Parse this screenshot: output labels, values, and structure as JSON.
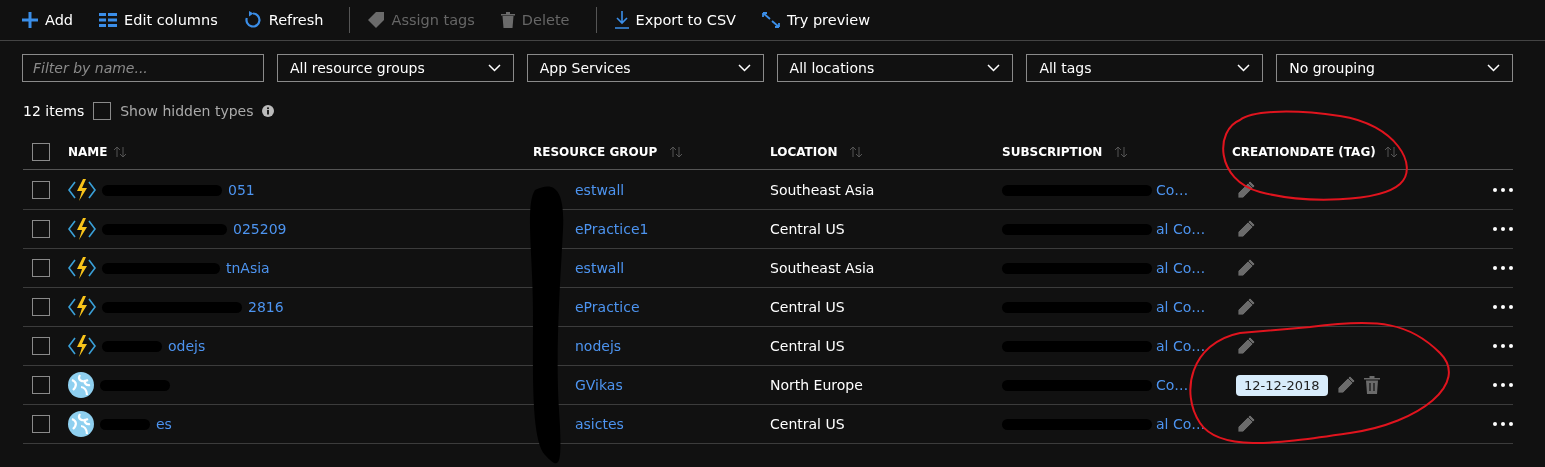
{
  "toolbar": [
    {
      "kind": "add",
      "label": "Add",
      "disabled": false
    },
    {
      "kind": "columns",
      "label": "Edit columns",
      "disabled": false
    },
    {
      "kind": "refresh",
      "label": "Refresh",
      "disabled": false
    },
    {
      "kind": "tag",
      "label": "Assign tags",
      "disabled": true
    },
    {
      "kind": "delete",
      "label": "Delete",
      "disabled": true
    },
    {
      "kind": "export",
      "label": "Export to CSV",
      "disabled": false
    },
    {
      "kind": "preview",
      "label": "Try preview",
      "disabled": false
    }
  ],
  "filter": {
    "placeholder": "Filter by name..."
  },
  "dropdowns": [
    "All resource groups",
    "App Services",
    "All locations",
    "All tags",
    "No grouping"
  ],
  "count": "12 items",
  "show_hidden": {
    "label": "Show hidden types",
    "checked": false
  },
  "select_all": {
    "checked": false
  },
  "columns": [
    "NAME",
    "RESOURCE GROUP",
    "LOCATION",
    "SUBSCRIPTION",
    "CREATIONDATE (TAG)"
  ],
  "rows": [
    {
      "kind": "function",
      "name": "051",
      "group": "estwall",
      "location": "Southeast Asia",
      "subscription": "Co…",
      "checked": false
    },
    {
      "kind": "function",
      "name": "025209",
      "group": "ePractice1",
      "location": "Central US",
      "subscription": "al Co…",
      "checked": false
    },
    {
      "kind": "function",
      "name": "tnAsia",
      "group": "estwall",
      "location": "Southeast Asia",
      "subscription": "al Co…",
      "checked": false
    },
    {
      "kind": "function",
      "name": "2816",
      "group": "ePractice",
      "location": "Central US",
      "subscription": "al Co…",
      "checked": false
    },
    {
      "kind": "function",
      "name": "odejs",
      "group": "nodejs",
      "location": "Central US",
      "subscription": "al Co…",
      "checked": false
    },
    {
      "kind": "web",
      "group": "GVikas",
      "location": "North Europe",
      "subscription": "Co…",
      "tag": "12-12-2018",
      "checked": false
    },
    {
      "kind": "web",
      "name": "es",
      "group": "asictes",
      "location": "Central US",
      "subscription": "al Co…",
      "checked": false
    }
  ]
}
